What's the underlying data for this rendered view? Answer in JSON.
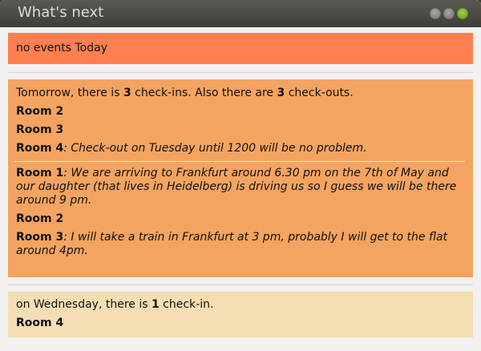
{
  "window": {
    "title": "What's next"
  },
  "today": {
    "text": "no events Today"
  },
  "tomorrow": {
    "intro_prefix": "Tomorrow, there is ",
    "checkins": "3",
    "intro_middle": " check-ins. Also there are ",
    "checkouts": "3",
    "intro_suffix": " check-outs.",
    "checkin_rooms": [
      {
        "room": "Room 2",
        "note": ""
      },
      {
        "room": "Room 3",
        "note": ""
      },
      {
        "room": "Room 4",
        "note": ": Check-out on Tuesday until 1200 will be no problem."
      }
    ],
    "checkout_rooms": [
      {
        "room": "Room 1",
        "note": ": We are arriving to Frankfurt around 6.30 pm on the 7th of May and our daughter (that lives in Heidelberg) is driving us so I guess we will be there around 9 pm."
      },
      {
        "room": "Room 2",
        "note": ""
      },
      {
        "room": "Room 3",
        "note_line1": ": I will take a train in Frankfurt at 3 pm, probably I will get to the flat",
        "note_line2": "around 4pm."
      }
    ]
  },
  "wednesday": {
    "intro_prefix": "on Wednesday, there is ",
    "checkins": "1",
    "intro_suffix": " check-in.",
    "rooms": [
      {
        "room": "Room 4"
      }
    ]
  },
  "colors": {
    "today": "#ff7f50",
    "tomorrow": "#f4a460",
    "wednesday": "#f5deb3"
  }
}
